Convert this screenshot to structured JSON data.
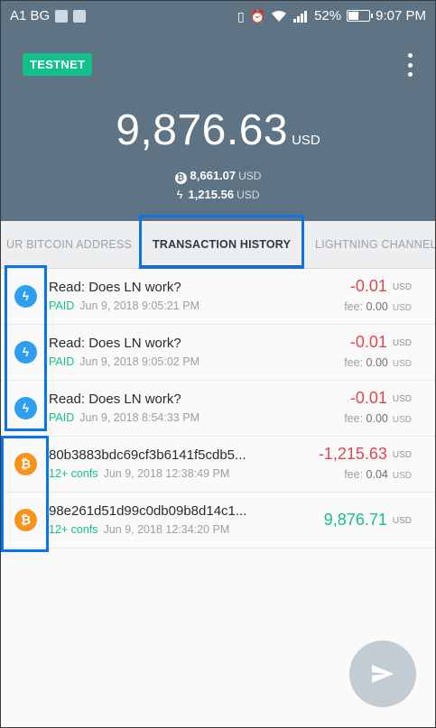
{
  "status_bar": {
    "carrier": "A1 BG",
    "battery": "52%",
    "battery_level": 0.52,
    "time": "9:07 PM"
  },
  "header": {
    "badge": "TESTNET",
    "balance": "9,876.63",
    "balance_unit": "USD",
    "bitcoin_balance": "8,661.07",
    "bitcoin_unit": "USD",
    "lightning_balance": "1,215.56",
    "lightning_unit": "USD"
  },
  "tabs": [
    {
      "label": "UR BITCOIN ADDRESS"
    },
    {
      "label": "TRANSACTION HISTORY"
    },
    {
      "label": "LIGHTNING CHANNELS"
    }
  ],
  "transactions": [
    {
      "type": "lightning",
      "title": "Read: Does LN work?",
      "status": "PAID",
      "date": "Jun 9, 2018 9:05:21 PM",
      "amount": "-0.01",
      "unit": "USD",
      "fee_label": "fee:",
      "fee": "0.00",
      "fee_unit": "USD"
    },
    {
      "type": "lightning",
      "title": "Read: Does LN work?",
      "status": "PAID",
      "date": "Jun 9, 2018 9:05:02 PM",
      "amount": "-0.01",
      "unit": "USD",
      "fee_label": "fee:",
      "fee": "0.00",
      "fee_unit": "USD"
    },
    {
      "type": "lightning",
      "title": "Read: Does LN work?",
      "status": "PAID",
      "date": "Jun 9, 2018 8:54:33 PM",
      "amount": "-0.01",
      "unit": "USD",
      "fee_label": "fee:",
      "fee": "0.00",
      "fee_unit": "USD"
    },
    {
      "type": "bitcoin",
      "title": "80b3883bdc69cf3b6141f5cdb5...",
      "status": "12+ confs",
      "date": "Jun 9, 2018 12:38:49 PM",
      "amount": "-1,215.63",
      "unit": "USD",
      "fee_label": "fee:",
      "fee": "0.04",
      "fee_unit": "USD"
    },
    {
      "type": "bitcoin",
      "title": "98e261d51d99c0db09b8d14c1...",
      "status": "12+ confs",
      "date": "Jun 9, 2018 12:34:20 PM",
      "amount": "9,876.71",
      "unit": "USD"
    }
  ],
  "icons": {
    "lightning": "lightning-bolt-icon",
    "bitcoin": "bitcoin-icon",
    "send": "send-icon",
    "menu": "more-vertical-icon"
  },
  "colors": {
    "header_bg": "#5e7384",
    "accent_green": "#14c08a",
    "negative_red": "#e0474f",
    "lightning_blue": "#2e9ef0",
    "bitcoin_orange": "#f7931a",
    "highlight_blue": "#0a74e8"
  }
}
